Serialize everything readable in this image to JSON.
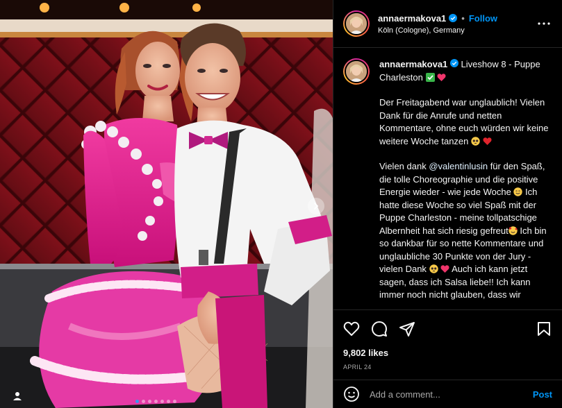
{
  "header": {
    "username": "annaermakova1",
    "verified": true,
    "follow_label": "Follow",
    "location": "Köln (Cologne), Germany"
  },
  "caption": {
    "username": "annaermakova1",
    "title": "Liveshow 8 - Puppe Charleston",
    "title_emojis": [
      "check-mark-button-emoji",
      "sparkling-heart-emoji"
    ],
    "para1": "Der Freitagabend war unglaublich! Vielen Dank für die Anrufe und netten Kommentare, ohne euch würden wir keine weitere Woche tanzen",
    "para1_emojis": [
      "pleading-face-emoji",
      "red-heart-emoji"
    ],
    "p2_a": "Vielen dank ",
    "p2_mention": "@valentinlusin",
    "p2_b": " für den Spaß, die tolle Choreographie und die positive Energie wieder - wie jede Woche",
    "p2_c": " Ich hatte diese Woche so viel Spaß mit der Puppe Charleston - meine tollpatschige Albernheit hat sich riesig gefreut",
    "p2_d": " Ich bin so dankbar für so nette Kommentare und unglaubliche 30 Punkte von der Jury - vielen Dank",
    "p2_e": " Auch ich kann jetzt sagen, dass ich Salsa liebe!! Ich kann immer noch nicht glauben, dass wir"
  },
  "actions": {
    "likes": "9,802 likes",
    "date": "APRIL 24"
  },
  "comment": {
    "placeholder": "Add a comment...",
    "post_label": "Post"
  },
  "colors": {
    "accent": "#0095f6",
    "background": "#000000",
    "divider": "#262626",
    "costume_pink": "#e0228e"
  },
  "carousel": {
    "slides": 7,
    "active": 1
  }
}
